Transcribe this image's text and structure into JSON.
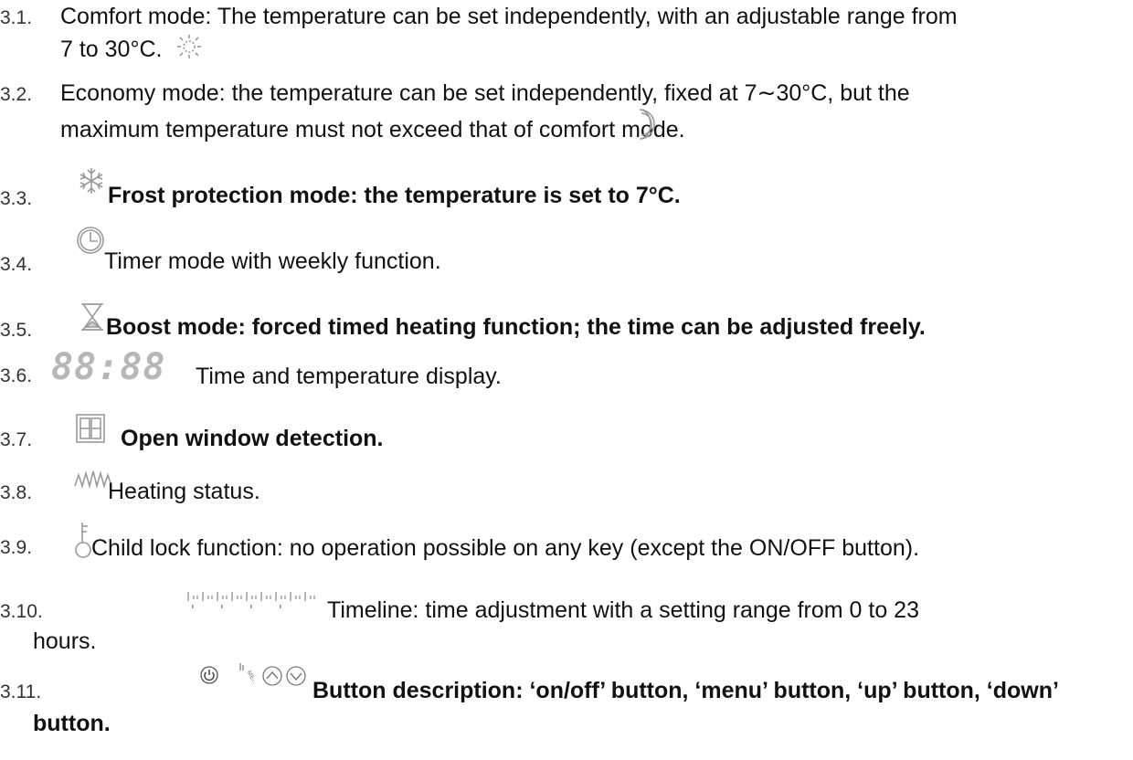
{
  "items": [
    {
      "num": "3.1.",
      "line1": "Comfort mode: The temperature can be set independently, with an adjustable range from",
      "line2": "7 to 30°C."
    },
    {
      "num": "3.2.",
      "line1": "Economy mode: the temperature can be set independently, fixed at 7∼30°C, but the",
      "line2": "maximum temperature must not exceed that of comfort mode."
    },
    {
      "num": "3.3.",
      "text": "Frost protection mode: the temperature is set to 7°C."
    },
    {
      "num": "3.4.",
      "text": "Timer mode with weekly function."
    },
    {
      "num": "3.5.",
      "text": "Boost mode: forced timed heating function; the time can be adjusted freely."
    },
    {
      "num": "3.6.",
      "display": "88:88",
      "text": "Time and temperature display."
    },
    {
      "num": "3.7.",
      "text": "Open window detection."
    },
    {
      "num": "3.8.",
      "text": "Heating status."
    },
    {
      "num": "3.9.",
      "text": "Child lock function: no operation possible on any key (except the ON/OFF button)."
    },
    {
      "num": "3.10.",
      "line1": "Timeline: time adjustment with a setting range from 0 to 23",
      "line2": "hours."
    },
    {
      "num": "3.11.",
      "line1": "Button description: ‘on/off’ button, ‘menu’ button, ‘up’ button, ‘down’",
      "line2": "button."
    }
  ],
  "icons": {
    "comfort": "sun-icon",
    "economy": "moon-icon",
    "frost": "snowflake-icon",
    "timer": "clock-icon",
    "boost": "hourglass-icon",
    "display": "seven-segment-display",
    "window": "window-icon",
    "heating": "heating-wave-icon",
    "lock": "key-icon",
    "timeline": "timeline-icon",
    "buttons": [
      "power-icon",
      "menu-icon",
      "up-icon",
      "down-icon"
    ]
  },
  "menu_icon_text": "MENU"
}
